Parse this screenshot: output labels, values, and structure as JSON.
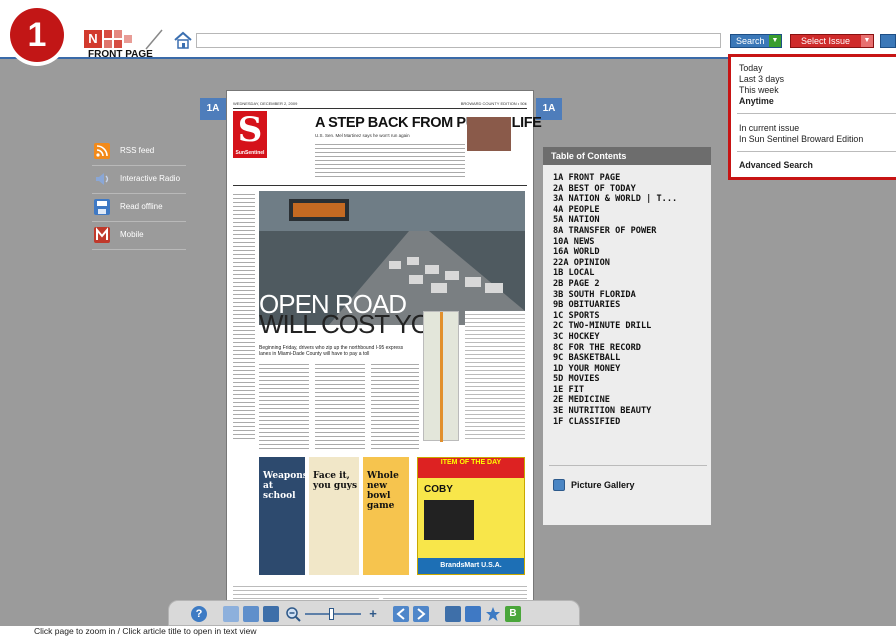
{
  "step_badge": "1",
  "header": {
    "page_label": "FRONT PAGE",
    "address_value": "",
    "search_button": "Search",
    "issue_button": "Select Issue"
  },
  "page_tag": "1A",
  "left_panel": {
    "items": [
      {
        "label": "RSS feed",
        "icon": "rss-icon",
        "color": "#f28a1a"
      },
      {
        "label": "Interactive Radio",
        "icon": "speaker-icon",
        "color": "#8aa7d6"
      },
      {
        "label": "Read offline",
        "icon": "save-icon",
        "color": "#3f79c4"
      },
      {
        "label": "Mobile",
        "icon": "mobile-icon",
        "color": "#c0392b"
      }
    ]
  },
  "newspaper": {
    "date_left": "WEDNESDAY, DECEMBER 2, 2009",
    "date_right": "BROWARD COUNTY EDITION • 50¢",
    "headline": "A STEP BACK FROM PUBLIC LIFE",
    "subhead": "U.S. Sen. Mel Martinez says he won't run again",
    "brand": "SunSentinel",
    "photo_title_1": "OPEN ROAD",
    "photo_title_2": "WILL COST YOU",
    "lede": "Beginning Friday, drivers who zip up the northbound I-95 express lanes in Miami-Dade County will have to pay a toll",
    "box1": "Weapons at school",
    "box2": "Face it, you guys",
    "box3": "Whole new bowl game",
    "ad_head": "ITEM OF THE DAY",
    "ad_brand": "COBY",
    "ad_store": "BrandsMart U.S.A."
  },
  "toc": {
    "title": "Table of Contents",
    "items": [
      "1A  FRONT PAGE",
      "2A  BEST OF TODAY",
      "3A  NATION & WORLD | T...",
      "4A  PEOPLE",
      "5A  NATION",
      "8A  TRANSFER OF POWER",
      "10A NEWS",
      "16A WORLD",
      "22A OPINION",
      "1B  LOCAL",
      "2B  PAGE 2",
      "3B  SOUTH FLORIDA",
      "9B  OBITUARIES",
      "1C  SPORTS",
      "2C  TWO-MINUTE DRILL",
      "3C  HOCKEY",
      "8C  FOR THE RECORD",
      "9C  BASKETBALL",
      "1D  YOUR MONEY",
      "5D  MOVIES",
      "1E  FIT",
      "2E  MEDICINE",
      "3E  NUTRITION BEAUTY",
      "1F  CLASSIFIED"
    ],
    "gallery_label": "Picture Gallery"
  },
  "search_dropdown": {
    "time_options": [
      "Today",
      "Last 3 days",
      "This week",
      "Anytime"
    ],
    "scope_options": [
      "In current issue",
      "In Sun Sentinel Broward Edition"
    ],
    "advanced": "Advanced Search"
  },
  "status_text": "Click page to zoom in / Click article title to open in text view",
  "colors": {
    "accent_blue": "#4e7dbb",
    "highlight_red": "#c71414",
    "background": "#9b9b9b"
  }
}
